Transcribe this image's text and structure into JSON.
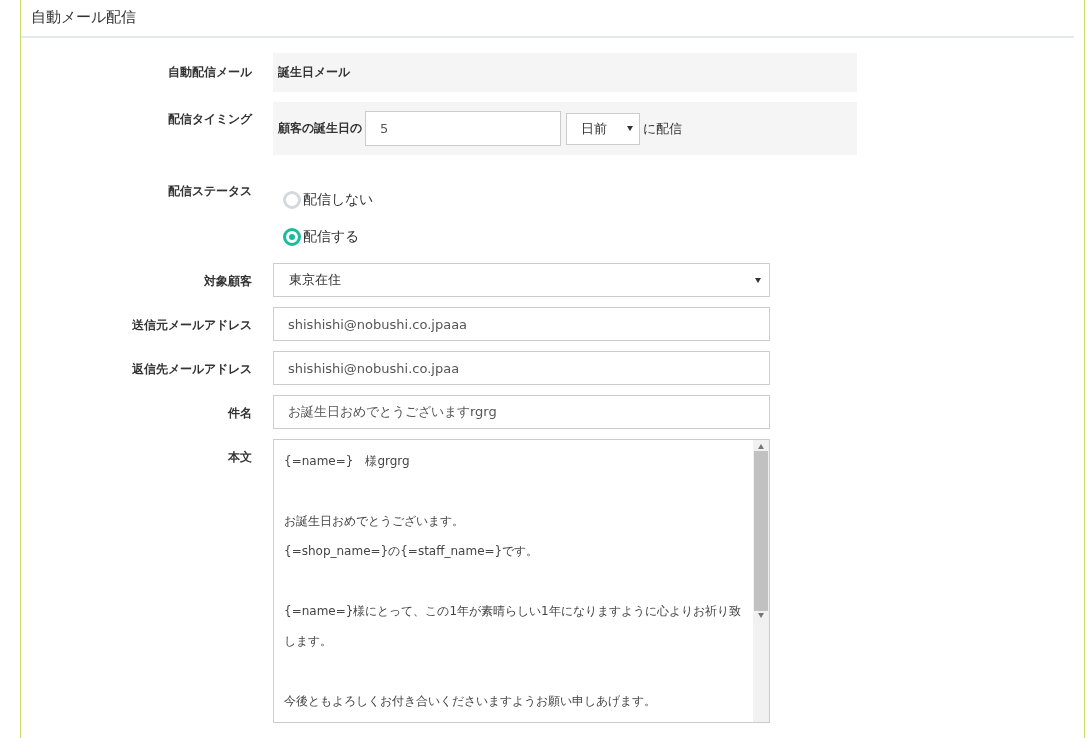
{
  "title": "自動メール配信",
  "fields": [
    {
      "kind": "static",
      "label": "自動配信メール",
      "value": "誕生日メール"
    },
    {
      "kind": "timing",
      "label": "配信タイミング",
      "prefix": "顧客の誕生日の",
      "value": "5",
      "unit": "日前",
      "suffix": "に配信"
    },
    {
      "kind": "radio",
      "label": "配信ステータス",
      "options": [
        {
          "label": "配信しない",
          "selected": false
        },
        {
          "label": "配信する",
          "selected": true
        }
      ]
    },
    {
      "kind": "select",
      "label": "対象顧客",
      "value": "東京在住"
    },
    {
      "kind": "text",
      "label": "送信元メールアドレス",
      "value": "shishishi@nobushi.co.jpaaa"
    },
    {
      "kind": "text",
      "label": "返信先メールアドレス",
      "value": "shishishi@nobushi.co.jpaa"
    },
    {
      "kind": "text",
      "label": "件名",
      "value": "お誕生日おめでとうございますrgrg"
    },
    {
      "kind": "textarea",
      "label": "本文",
      "paragraphs": [
        [
          "{=name=}　様grgrg"
        ],
        [
          "お誕生日おめでとうございます。",
          "{=shop_name=}の{=staff_name=}です。"
        ],
        [
          "{=name=}様にとって、この1年が素晴らしい1年になりますように心よりお祈り致します。"
        ],
        [
          "今後ともよろしくお付き合いくださいますようお願い申しあげます。"
        ]
      ]
    }
  ]
}
